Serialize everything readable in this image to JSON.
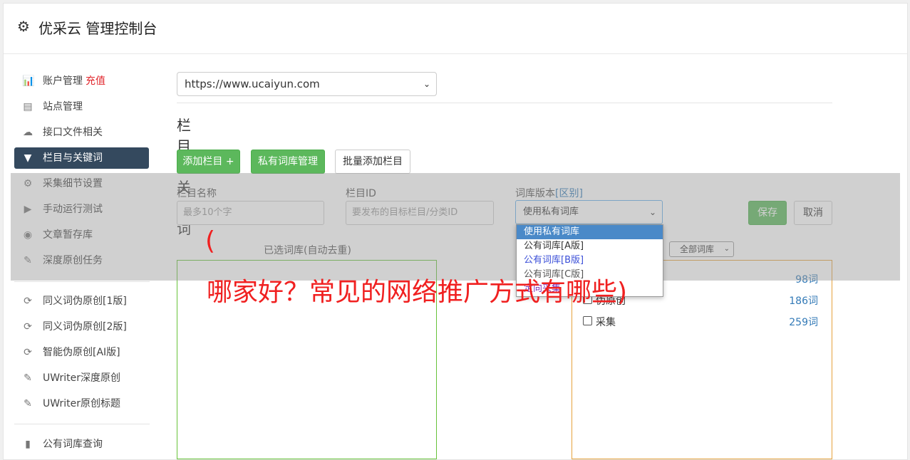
{
  "header": {
    "title": "优采云 管理控制台",
    "icon": "gear-icon"
  },
  "sidebar": {
    "items": [
      {
        "label": "账户管理",
        "badge": "充值",
        "icon": "bar-chart-icon"
      },
      {
        "label": "站点管理",
        "icon": "server-icon"
      },
      {
        "label": "接口文件相关",
        "icon": "cloud-upload-icon"
      },
      {
        "label": "栏目与关键词",
        "icon": "filter-icon",
        "active": true
      },
      {
        "label": "采集细节设置",
        "icon": "cogs-icon"
      },
      {
        "label": "手动运行测试",
        "icon": "play-circle-icon"
      },
      {
        "label": "文章暂存库",
        "icon": "database-icon"
      },
      {
        "label": "深度原创任务",
        "icon": "edit-icon"
      },
      {
        "label": "同义词伪原创[1版]",
        "icon": "refresh-icon"
      },
      {
        "label": "同义词伪原创[2版]",
        "icon": "refresh-icon"
      },
      {
        "label": "智能伪原创[AI版]",
        "icon": "refresh-icon"
      },
      {
        "label": "UWriter深度原创",
        "icon": "edit-icon"
      },
      {
        "label": "UWriter原创标题",
        "icon": "edit-icon"
      },
      {
        "label": "公有词库查询",
        "icon": "book-icon"
      }
    ]
  },
  "main": {
    "site_select": "https://www.ucaiyun.com",
    "section_title": "栏目与关键词",
    "buttons": {
      "add_column": "添加栏目 +",
      "private_lib": "私有词库管理",
      "batch_add": "批量添加栏目"
    },
    "form": {
      "name_label": "栏目名称",
      "name_placeholder": "最多10个字",
      "id_label": "栏目ID",
      "id_placeholder": "要发布的目标栏目/分类ID",
      "version_label": "词库版本",
      "version_link": "[区别]",
      "version_value": "使用私有词库",
      "save": "保存",
      "cancel": "取消"
    },
    "dropdown_options": [
      "使用私有词库",
      "公有词库[A版]",
      "公有词库[B版]",
      "公有词库[C版]",
      "定向采集"
    ],
    "selected_label": "已选词库(自动去重)",
    "lib_filter": "全部词库",
    "libraries": [
      {
        "name": "",
        "count": "98词"
      },
      {
        "name": "伪原创",
        "count": "186词"
      },
      {
        "name": "采集",
        "count": "259词"
      }
    ]
  },
  "watermark": {
    "line1": "(",
    "line2": "哪家好？常见的网络推广方式有哪些)"
  },
  "colors": {
    "active_nav": "#34495e",
    "green": "#5cb85c",
    "red": "#e1262c",
    "link": "#337ab7"
  }
}
